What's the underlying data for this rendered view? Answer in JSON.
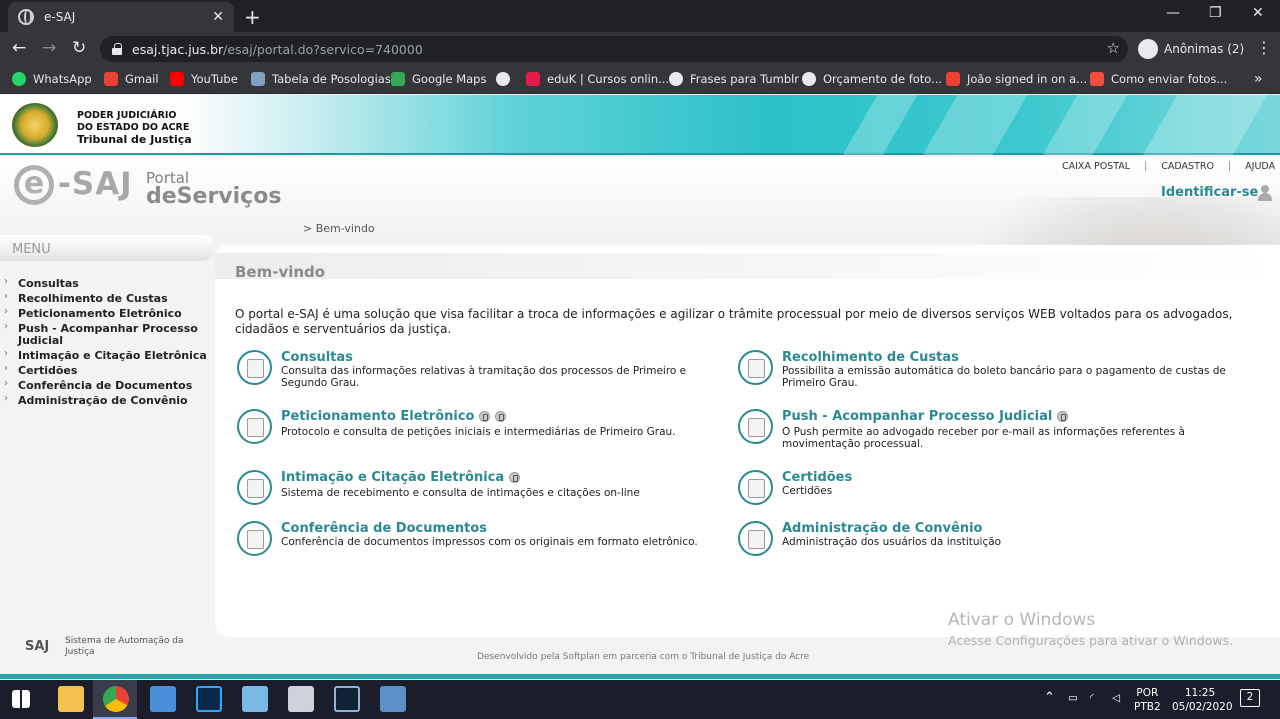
{
  "browser": {
    "tab_title": "e-SAJ",
    "tab_close": "✕",
    "new_tab": "+",
    "url_host": "esaj.tjac.jus.br",
    "url_path": "/esaj/portal.do?servico=740000",
    "profile_label": "Anônimas (2)",
    "bookmarks": [
      "WhatsApp",
      "Gmail",
      "YouTube",
      "Tabela de Posologias",
      "Google Maps",
      "",
      "eduK | Cursos onlin...",
      "Frases para Tumblr",
      "Orçamento de foto...",
      "João signed in on a...",
      "Como enviar fotos..."
    ]
  },
  "court": {
    "line1": "PODER JUDICIÁRIO",
    "line2": "DO ESTADO DO ACRE",
    "line3": "Tribunal de Justiça"
  },
  "logo": {
    "e": "e",
    "saj": "-SAJ",
    "portal": "Portal",
    "de": "de",
    "servicos": "Serviços"
  },
  "top_links": [
    "CAIXA POSTAL",
    "CADASTRO",
    "AJUDA"
  ],
  "identify_label": "Identificar-se",
  "breadcrumb": "> Bem-vindo",
  "menu": {
    "title": "MENU",
    "items": [
      "Consultas",
      "Recolhimento de Custas",
      "Peticionamento Eletrônico",
      "Push - Acompanhar Processo Judicial",
      "Intimação e Citação Eletrônica",
      "Certidões",
      "Conferência de Documentos",
      "Administração de Convênio"
    ]
  },
  "main": {
    "title": "Bem-vindo",
    "intro": "O portal e-SAJ é uma solução que visa facilitar a troca de informações e agilizar o trâmite processual por meio de diversos serviços WEB voltados para os advogados, cidadãos e serventuários da justiça.",
    "services": [
      {
        "name": "Consultas",
        "desc": "Consulta das informações relativas à tramitação dos processos de Primeiro e Segundo Grau."
      },
      {
        "name": "Recolhimento de Custas",
        "desc": "Possibilita a emissão automática do boleto bancário para o pagamento de custas de Primeiro Grau."
      },
      {
        "name": "Peticionamento Eletrônico",
        "desc": "Protocolo e consulta de petições iniciais e intermediárias de Primeiro Grau."
      },
      {
        "name": "Push - Acompanhar Processo Judicial",
        "desc": "O Push permite ao advogado receber por e-mail as informações referentes à movimentação processual."
      },
      {
        "name": "Intimação e Citação Eletrônica",
        "desc": "Sistema de recebimento e consulta de intimações e citações on-line"
      },
      {
        "name": "Certidões",
        "desc": "Certidões"
      },
      {
        "name": "Conferência de Documentos",
        "desc": "Conferência de documentos impressos com os originais em formato eletrônico."
      },
      {
        "name": "Administração de Convênio",
        "desc": "Administração dos usuários da instituição"
      }
    ]
  },
  "footer": {
    "saj": "SAJ",
    "system": "Sistema de Automação da Justiça",
    "developed": "Desenvolvido pela Softplan em parceria com o Tribunal de Justiça do Acre"
  },
  "watermark": {
    "line1": "Ativar o Windows",
    "line2": "Acesse Configurações para ativar o Windows."
  },
  "taskbar": {
    "lang1": "POR",
    "lang2": "PTB2",
    "time": "11:25",
    "date": "05/02/2020",
    "notifications": "2"
  }
}
